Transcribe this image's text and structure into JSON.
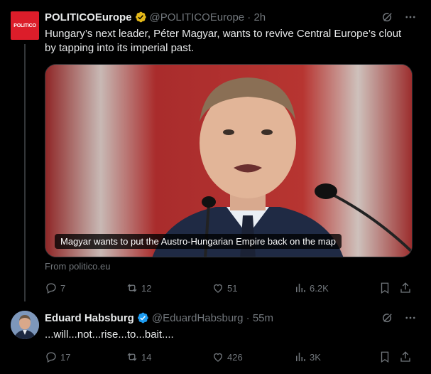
{
  "tweet1": {
    "avatar_text": "POLITICO",
    "display_name": "POLITICOEurope",
    "handle_time": "@POLITICOEurope · 2h",
    "text_line1": "Hungary’s next leader, Péter Magyar, wants to revive Central Europe’s clout",
    "text_line2": "by tapping into its imperial past.",
    "media_caption": "Magyar wants to put the Austro-Hungarian Empire back on the map",
    "source": "From politico.eu",
    "replies": "7",
    "reposts": "12",
    "likes": "51",
    "views": "6.2K"
  },
  "tweet2": {
    "display_name": "Eduard Habsburg",
    "handle_time": "@EduardHabsburg · 55m",
    "text": "...will...not...rise...to...bait....",
    "replies": "17",
    "reposts": "14",
    "likes": "426",
    "views": "3K"
  },
  "colors": {
    "background": "#000000",
    "text": "#e7e9ea",
    "muted": "#71767b",
    "gold_badge": "#e2b719",
    "blue_badge": "#1d9bf0",
    "politico_red": "#dc1d2a"
  },
  "icons": [
    "grok-icon",
    "more-icon",
    "reply-icon",
    "repost-icon",
    "like-icon",
    "views-icon",
    "bookmark-icon",
    "share-icon",
    "verified-gold-icon",
    "verified-blue-icon"
  ]
}
